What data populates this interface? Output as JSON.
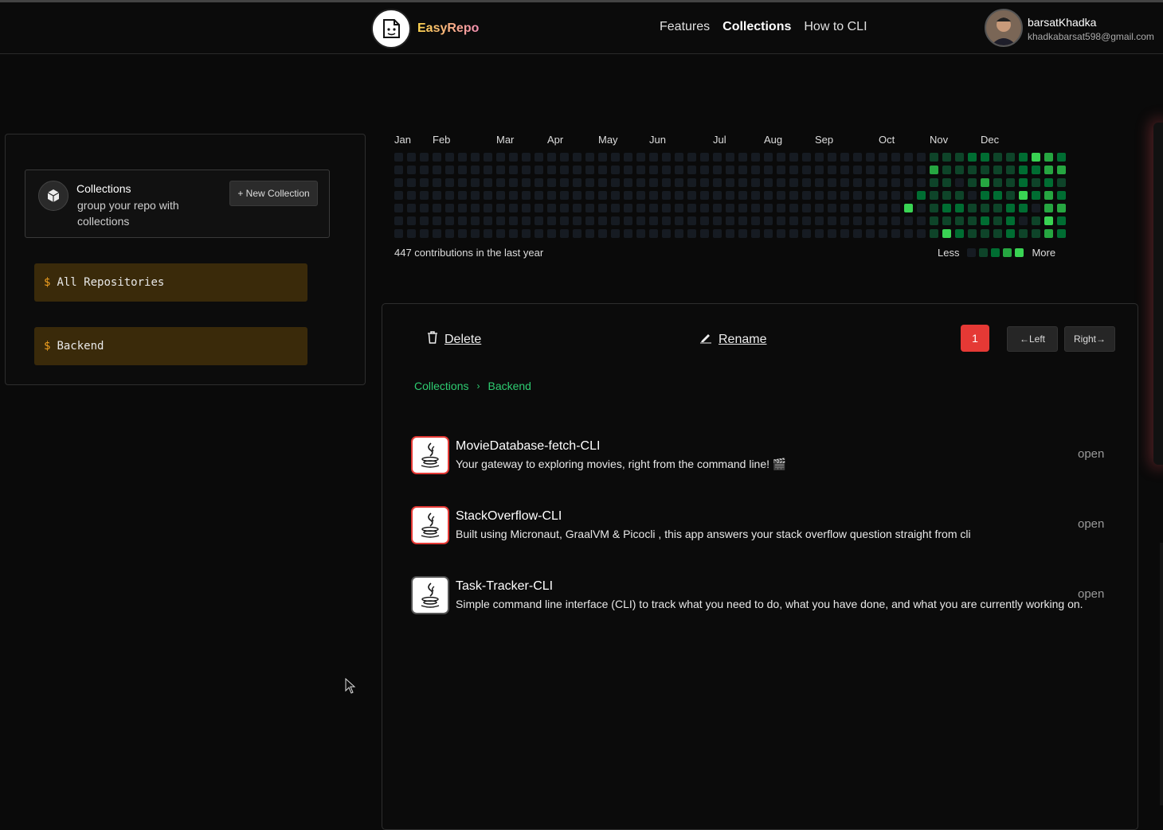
{
  "header": {
    "brand": "EasyRepo",
    "nav": [
      {
        "label": "Features",
        "active": false
      },
      {
        "label": "Collections",
        "active": true
      },
      {
        "label": "How to CLI",
        "active": false
      }
    ],
    "user": {
      "name": "barsatKhadka",
      "email": "khadkabarsat598@gmail.com"
    }
  },
  "sidebar": {
    "collections_card": {
      "title": "Collections",
      "subtitle": "group your repo with collections",
      "new_button": "+ New Collection"
    },
    "items": [
      {
        "prefix": "$",
        "label": "All Repositories"
      },
      {
        "prefix": "$",
        "label": "Backend"
      }
    ]
  },
  "heatmap": {
    "months": [
      "Jan",
      "Feb",
      "Mar",
      "Apr",
      "May",
      "Jun",
      "Jul",
      "Aug",
      "Sep",
      "Oct",
      "Nov",
      "Dec"
    ],
    "summary": "447 contributions in the last year",
    "legend_less": "Less",
    "legend_more": "More",
    "colors": [
      "#161b22",
      "#0e4429",
      "#006d32",
      "#26a641",
      "#39d353"
    ]
  },
  "main": {
    "delete_label": "Delete",
    "rename_label": "Rename",
    "page": "1",
    "left_label": "←Left",
    "right_label": "Right→",
    "breadcrumb": [
      "Collections",
      "Backend"
    ],
    "repos": [
      {
        "name": "MovieDatabase-fetch-CLI",
        "desc": "Your gateway to exploring movies, right from the command line! 🎬",
        "action": "open",
        "border": "red"
      },
      {
        "name": "StackOverflow-CLI",
        "desc": "Built using Micronaut, GraalVM & Picocli , this app answers your stack overflow question straight from cli",
        "action": "open",
        "border": "red"
      },
      {
        "name": "Task-Tracker-CLI",
        "desc": "Simple command line interface (CLI) to track what you need to do, what you have done, and what you are currently working on.",
        "action": "open",
        "border": "gray"
      }
    ]
  }
}
